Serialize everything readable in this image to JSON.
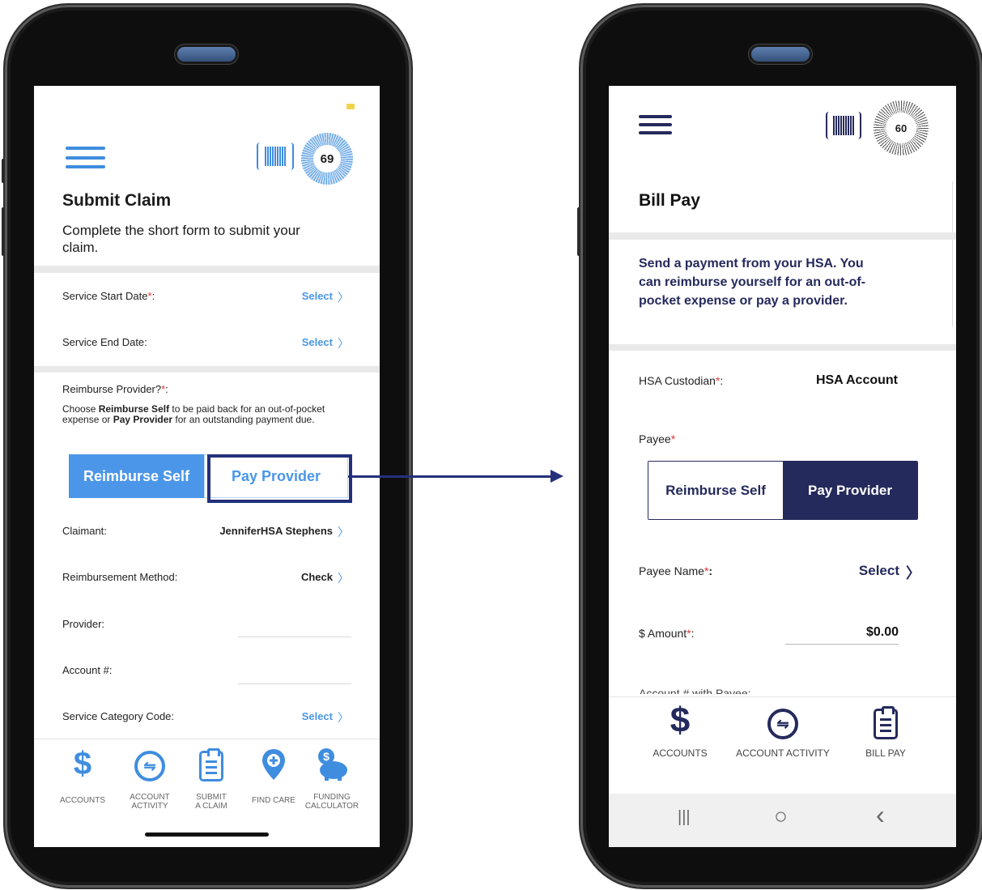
{
  "left_phone": {
    "score": "69",
    "title": "Submit Claim",
    "description": "Complete the short form to submit your claim.",
    "rows": {
      "start_date_label": "Service Start Date",
      "start_date_value": "Select",
      "end_date_label": "Service End Date:",
      "end_date_value": "Select",
      "reimburse_label": "Reimburse Provider?",
      "help_a": "Choose ",
      "help_b": "Reimburse Self",
      "help_c": " to be paid back for an out-of-pocket expense or ",
      "help_d": "Pay Provider",
      "help_e": " for an outstanding payment due.",
      "claimant_label": "Claimant:",
      "claimant_value": "JenniferHSA Stephens",
      "method_label": "Reimbursement Method:",
      "method_value": "Check",
      "provider_label": "Provider:",
      "account_label": "Account #:",
      "category_label": "Service Category Code:",
      "category_value": "Select"
    },
    "segment": {
      "a": "Reimburse Self",
      "b": "Pay Provider"
    },
    "nav": [
      {
        "label_1": "ACCOUNTS",
        "label_2": "",
        "icon": "dollar-icon"
      },
      {
        "label_1": "ACCOUNT",
        "label_2": "ACTIVITY",
        "icon": "exchange-icon"
      },
      {
        "label_1": "SUBMIT",
        "label_2": "A CLAIM",
        "icon": "clipboard-icon"
      },
      {
        "label_1": "FIND CARE",
        "label_2": "",
        "icon": "location-pin-icon"
      },
      {
        "label_1": "FUNDING",
        "label_2": "CALCULATOR",
        "icon": "piggy-bank-icon"
      }
    ],
    "colors": {
      "accent": "#4b96e8",
      "highlight": "#24307a"
    }
  },
  "right_phone": {
    "score": "60",
    "title": "Bill Pay",
    "description": "Send a payment from your HSA. You can reimburse yourself for an out-of-pocket expense or pay a provider.",
    "custodian_label": "HSA Custodian",
    "custodian_value": "HSA Account",
    "payee_label": "Payee",
    "segment": {
      "a": "Reimburse Self",
      "b": "Pay Provider"
    },
    "payee_name_label": "Payee Name",
    "payee_name_value": "Select",
    "amount_label": "$ Amount",
    "amount_value": "$0.00",
    "cut_label": "Account # with Payee:",
    "nav": [
      {
        "label": "ACCOUNTS",
        "icon": "dollar-icon"
      },
      {
        "label": "ACCOUNT ACTIVITY",
        "icon": "exchange-icon"
      },
      {
        "label": "BILL PAY",
        "icon": "clipboard-icon"
      }
    ],
    "system_nav": {
      "recents": "|||",
      "home": "○",
      "back": "‹"
    },
    "colors": {
      "accent": "#252a5c"
    }
  }
}
